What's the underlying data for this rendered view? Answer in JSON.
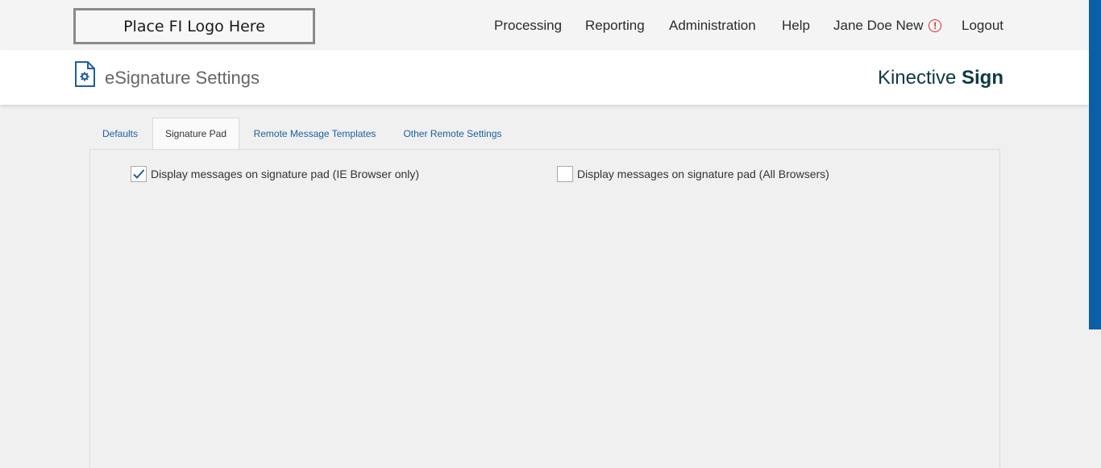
{
  "topbar": {
    "logo_text": "Place FI Logo Here",
    "nav": {
      "processing": "Processing",
      "reporting": "Reporting",
      "administration": "Administration",
      "help": "Help",
      "user": "Jane Doe New",
      "logout": "Logout"
    },
    "alert_glyph": "!"
  },
  "header": {
    "title": "eSignature Settings",
    "brand_light": "Kinective",
    "brand_bold": "Sign"
  },
  "tabs": [
    {
      "label": "Defaults",
      "active": false
    },
    {
      "label": "Signature Pad",
      "active": true
    },
    {
      "label": "Remote Message Templates",
      "active": false
    },
    {
      "label": "Other Remote Settings",
      "active": false
    }
  ],
  "options": [
    {
      "label": "Display messages on signature pad (IE Browser only)",
      "checked": true
    },
    {
      "label": "Display messages on signature pad (All Browsers)",
      "checked": false
    }
  ],
  "colors": {
    "accent": "#1e5fa0",
    "brand": "#0e3a45",
    "alert": "#e0282e",
    "scrollbar": "#0a5fa6"
  }
}
